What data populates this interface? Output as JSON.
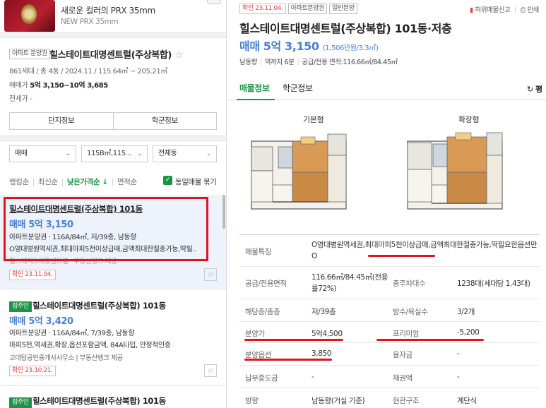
{
  "ad": {
    "title": "새로운 컬러의 PRX 35mm",
    "subtitle": "NEW PRX 35mm"
  },
  "complex": {
    "type_tag": "아파트 분양권",
    "name": "힐스테이트대명센트럴(주상복합)",
    "summary": "861세대 / 총 4동 / 2024.11 / 115.64㎡ ~ 205.21㎡",
    "sale_label": "매매가",
    "sale_range": "5억 3,150~10억 3,685",
    "jeonse_label": "전세가",
    "jeonse_value": "-",
    "buttons": [
      "단지정보",
      "학군정보"
    ]
  },
  "filters": {
    "deal": "매매",
    "area": "115B㎡,115...",
    "dong": "전체동"
  },
  "sorts": {
    "items": [
      "랭킹순",
      "최신순",
      "낮은가격순 ↓",
      "면적순"
    ],
    "active": 2,
    "same_label": "동일매물 묶기"
  },
  "listings": [
    {
      "tag": "",
      "title": "힐스테이트대명센트럴(주상복합) 101동",
      "price": "매매 5억 3,150",
      "spec": "아파트분양권 · 116A/84㎡, 저/39층, 남동향",
      "desc": "O영대병원역세권,최대마피5천이상급매,금액최대한절충가능,딱필..",
      "agent": "힐스테이트대명센트럴 · 부동산뱅크 제공",
      "confirm": "확인 23.11.04."
    },
    {
      "tag": "집주인",
      "title": "힐스테이트대명센트럴(주상복합) 101동",
      "price": "매매 5억 3,420",
      "spec": "아파트분양권 · 116A/84㎡, 7/39층, 남동향",
      "desc": "마피5천,역세권,확장,옵션포함금액, 84A타입, 안정적인증",
      "agent": "고대탑공인중개사사무소 | 부동산뱅크 제공",
      "confirm": "확인 23.10.21."
    },
    {
      "tag": "집주인",
      "title": "힐스테이트대명센트럴(주상복합) 101동"
    }
  ],
  "detail": {
    "tags": [
      "확인 23.11.04.",
      "아파트분양권",
      "일반분양"
    ],
    "actions": [
      "허위매물신고",
      "인쇄"
    ],
    "title": "힐스테이트대명센트럴(주상복합) 101동·저층",
    "price": "매매 5억 3,150",
    "price_per": "(1,506만원/3.3㎡)",
    "meta": [
      "남동향",
      "역까지 6분",
      "공급/전용 면적:116.66㎡/84.45㎡"
    ],
    "tabs": [
      "매물정보",
      "학군정보"
    ],
    "refresh": "평",
    "floorplans": [
      "기본형",
      "확장형"
    ],
    "table": [
      {
        "k": "매물특징",
        "v": "O영대병원역세권,최대마피5천이상급매,금액최대한절충가능,딱필요한옵션만O"
      },
      {
        "k": "공급/전용면적",
        "v": "116.66㎡/84.45㎡(전용률72%)",
        "k2": "총주차대수",
        "v2": "1238대(세대당 1.43대)"
      },
      {
        "k": "해당층/총층",
        "v": "저/39층",
        "k2": "방수/욕실수",
        "v2": "3/2개"
      },
      {
        "k": "분양가",
        "v": "5억4,500",
        "k2": "프리미엄",
        "v2": "-5,200"
      },
      {
        "k": "분양옵션",
        "v": "3,850",
        "k2": "융자금",
        "v2": "-"
      },
      {
        "k": "납부중도금",
        "v": "-",
        "k2": "채권액",
        "v2": "-"
      },
      {
        "k": "방향",
        "v": "남동향(거실 기준)",
        "k2": "현관구조",
        "v2": "계단식"
      }
    ]
  },
  "colors": {
    "accent_green": "#1a9447",
    "price_blue": "#4a7fd8",
    "highlight_red": "#e0141e"
  }
}
